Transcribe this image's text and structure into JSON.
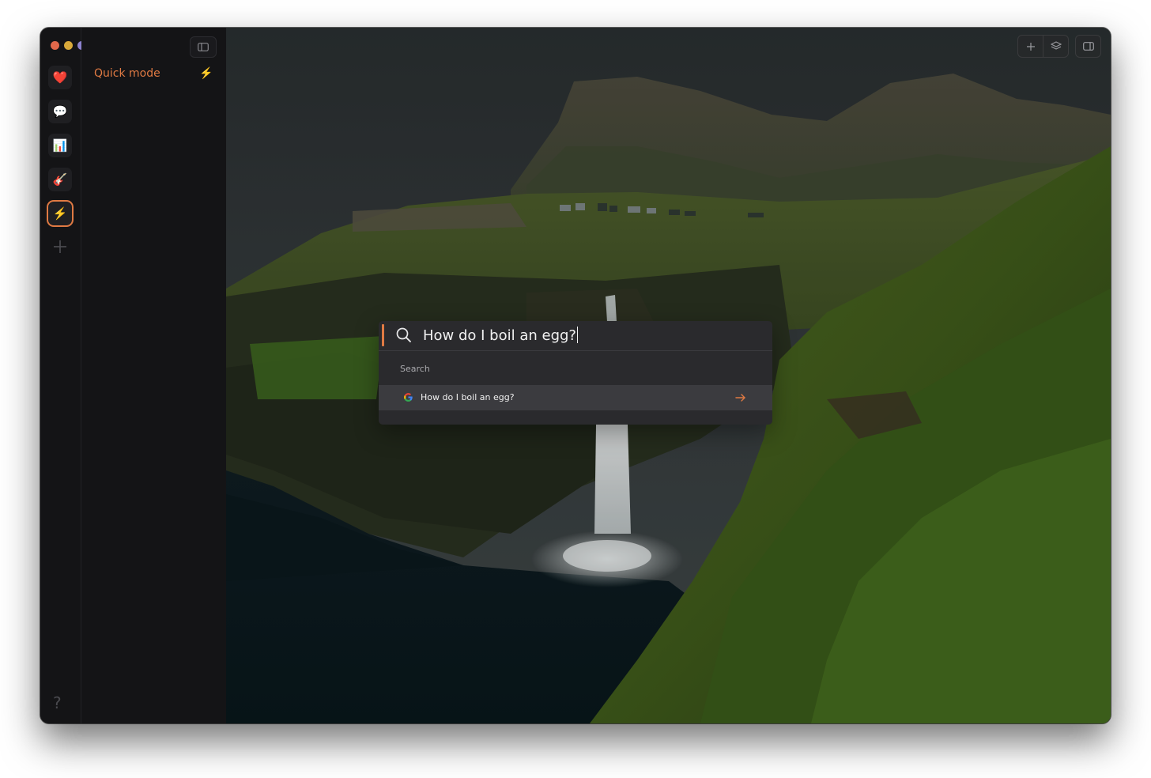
{
  "window": {
    "traffic_lights": [
      "#e0684b",
      "#d8a93a",
      "#8d82cf"
    ]
  },
  "rail": {
    "items": [
      {
        "icon": "heart-icon",
        "glyph": "❤️"
      },
      {
        "icon": "speech-bubble-icon",
        "glyph": "💬"
      },
      {
        "icon": "bar-chart-icon",
        "glyph": "📊"
      },
      {
        "icon": "guitar-icon",
        "glyph": "🎸"
      },
      {
        "icon": "lightning-icon",
        "glyph": "⚡"
      }
    ],
    "add_glyph": "+",
    "help_glyph": "?"
  },
  "sidebar": {
    "title": "Quick mode",
    "title_icon": "⚡",
    "accent_color": "#e07a43"
  },
  "palette": {
    "query": "How do I boil an egg?",
    "section_label": "Search",
    "results": [
      {
        "icon": "google-icon",
        "label": "How do I boil an egg?"
      }
    ]
  }
}
